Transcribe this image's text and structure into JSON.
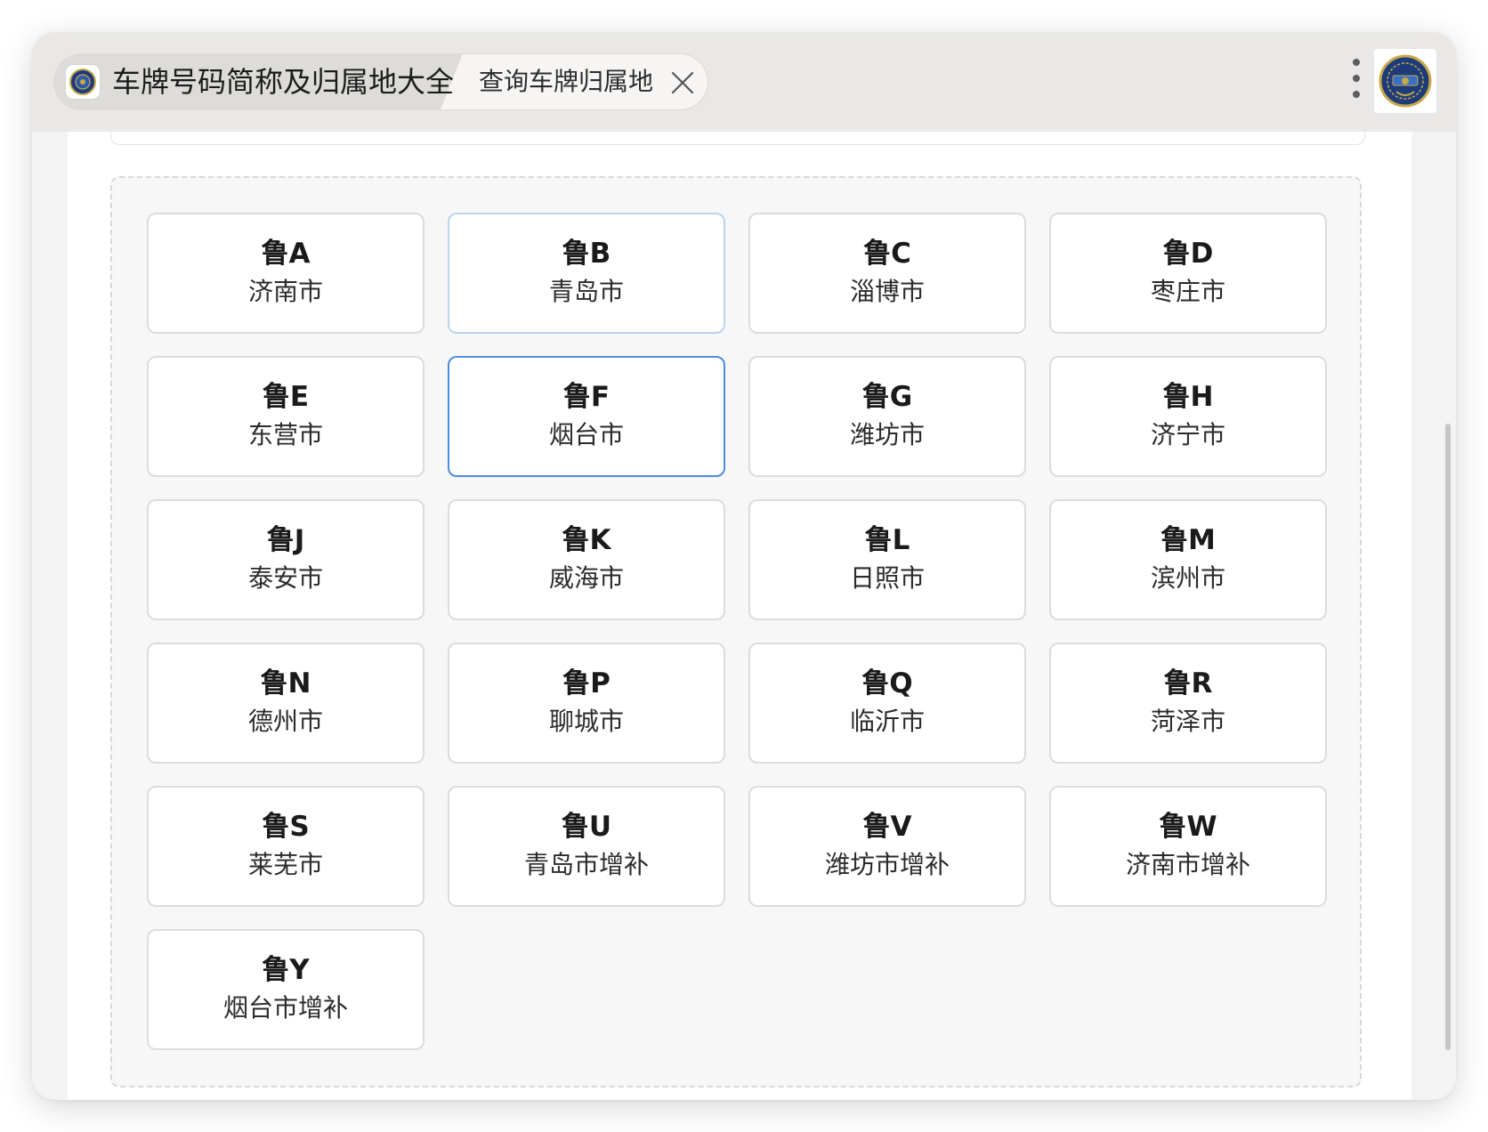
{
  "titlebar": {
    "tab_title": "车牌号码简称及归属地大全",
    "tab2_title": "查询车牌归属地",
    "favicon_icon": "police-emblem-icon",
    "close_icon": "close-icon",
    "menu_icon": "more-vertical-icon",
    "logo_icon": "police-emblem-icon"
  },
  "colors": {
    "titlebar_bg": "#e9e8e6",
    "panel_bg": "#f7f7f7",
    "selected_border": "#4e8ae0",
    "card_border": "#dcdcdc",
    "emblem_blue": "#1e3c7a",
    "emblem_gold": "#c9a94a"
  },
  "plates": [
    {
      "code": "鲁A",
      "city": "济南市",
      "state": "normal"
    },
    {
      "code": "鲁B",
      "city": "青岛市",
      "state": "hover"
    },
    {
      "code": "鲁C",
      "city": "淄博市",
      "state": "normal"
    },
    {
      "code": "鲁D",
      "city": "枣庄市",
      "state": "normal"
    },
    {
      "code": "鲁E",
      "city": "东营市",
      "state": "normal"
    },
    {
      "code": "鲁F",
      "city": "烟台市",
      "state": "selected"
    },
    {
      "code": "鲁G",
      "city": "潍坊市",
      "state": "normal"
    },
    {
      "code": "鲁H",
      "city": "济宁市",
      "state": "normal"
    },
    {
      "code": "鲁J",
      "city": "泰安市",
      "state": "normal"
    },
    {
      "code": "鲁K",
      "city": "威海市",
      "state": "normal"
    },
    {
      "code": "鲁L",
      "city": "日照市",
      "state": "normal"
    },
    {
      "code": "鲁M",
      "city": "滨州市",
      "state": "normal"
    },
    {
      "code": "鲁N",
      "city": "德州市",
      "state": "normal"
    },
    {
      "code": "鲁P",
      "city": "聊城市",
      "state": "normal"
    },
    {
      "code": "鲁Q",
      "city": "临沂市",
      "state": "normal"
    },
    {
      "code": "鲁R",
      "city": "菏泽市",
      "state": "normal"
    },
    {
      "code": "鲁S",
      "city": "莱芜市",
      "state": "normal"
    },
    {
      "code": "鲁U",
      "city": "青岛市增补",
      "state": "normal"
    },
    {
      "code": "鲁V",
      "city": "潍坊市增补",
      "state": "normal"
    },
    {
      "code": "鲁W",
      "city": "济南市增补",
      "state": "normal"
    },
    {
      "code": "鲁Y",
      "city": "烟台市增补",
      "state": "normal"
    }
  ]
}
